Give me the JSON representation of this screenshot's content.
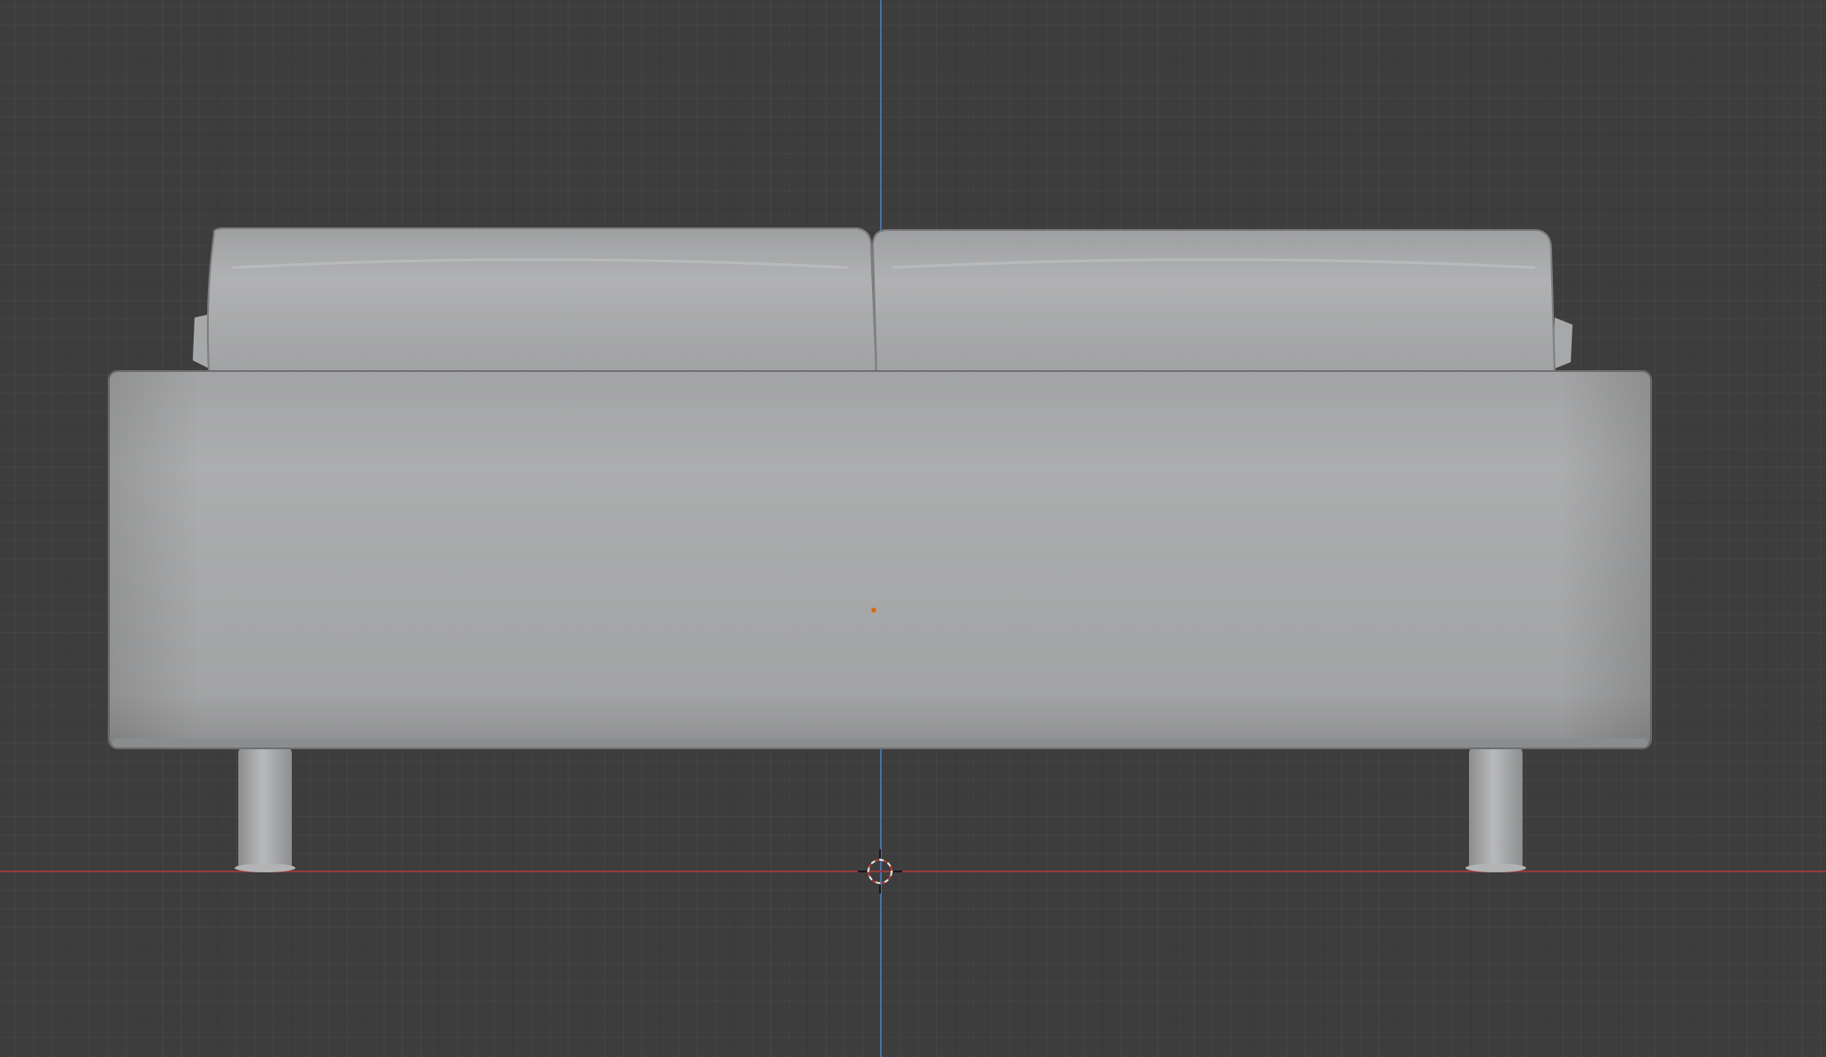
{
  "viewport": {
    "view": "front-orthographic",
    "object": "sofa-mesh",
    "colors": {
      "background": "#3d3d3d",
      "grid_minor": "#424242",
      "grid_major": "#363636",
      "axis_x": "#9a3a3a",
      "axis_z": "#4a6fa8",
      "mesh": "#a8a9aa",
      "origin": "#e07a1f"
    }
  },
  "icons": {
    "cursor": "3d-cursor-icon",
    "origin": "object-origin-icon"
  }
}
